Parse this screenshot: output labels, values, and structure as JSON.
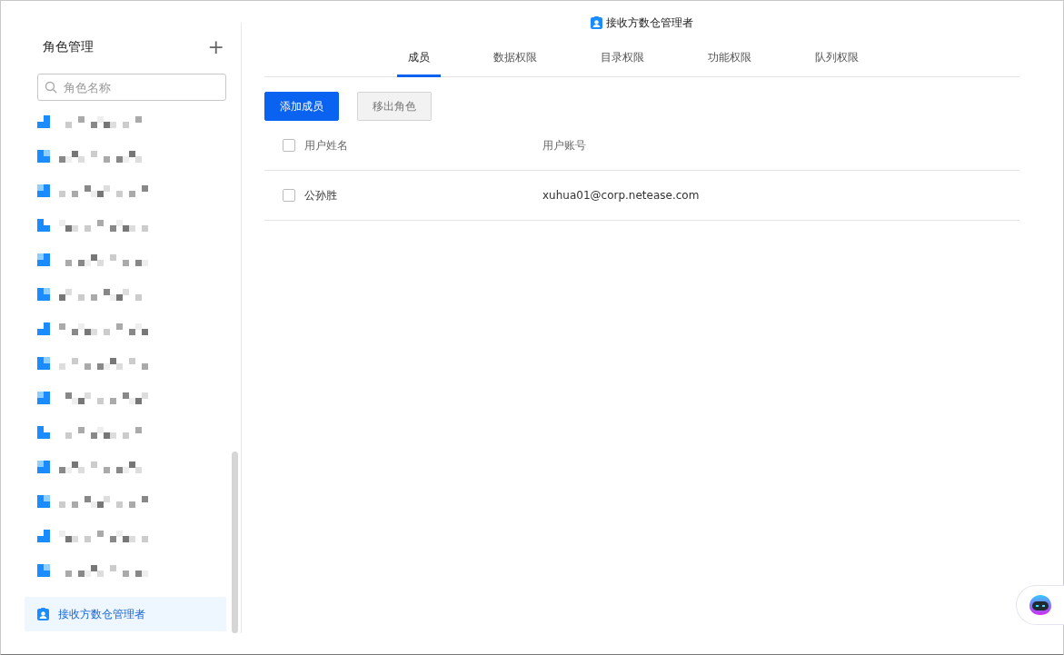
{
  "sidebar": {
    "title": "角色管理",
    "add_label": "+",
    "search": {
      "placeholder": "角色名称"
    },
    "items": [
      {
        "kind": "redacted",
        "selected": false
      },
      {
        "kind": "redacted",
        "selected": false
      },
      {
        "kind": "redacted",
        "selected": false
      },
      {
        "kind": "redacted",
        "selected": false
      },
      {
        "kind": "redacted",
        "selected": false
      },
      {
        "kind": "redacted",
        "selected": false
      },
      {
        "kind": "redacted",
        "selected": false
      },
      {
        "kind": "redacted",
        "selected": false
      },
      {
        "kind": "redacted",
        "selected": false
      },
      {
        "kind": "redacted",
        "selected": false
      },
      {
        "kind": "redacted",
        "selected": false
      },
      {
        "kind": "redacted",
        "selected": false
      },
      {
        "kind": "redacted",
        "selected": false
      },
      {
        "kind": "redacted",
        "selected": false
      },
      {
        "kind": "role",
        "label": "接收方数仓管理者",
        "selected": true
      }
    ]
  },
  "main": {
    "title": "接收方数仓管理者",
    "tabs": [
      {
        "label": "成员",
        "selected": true
      },
      {
        "label": "数据权限",
        "selected": false
      },
      {
        "label": "目录权限",
        "selected": false
      },
      {
        "label": "功能权限",
        "selected": false
      },
      {
        "label": "队列权限",
        "selected": false
      }
    ],
    "buttons": [
      {
        "label": "添加成员",
        "kind": "primary",
        "disabled": false
      },
      {
        "label": "移出角色",
        "kind": "default",
        "disabled": true
      }
    ],
    "table": {
      "columns": [
        "用户姓名",
        "用户账号"
      ],
      "header_checked": false,
      "rows": [
        {
          "name": "公孙胜",
          "account": "xuhua01@corp.netease.com",
          "checked": false
        }
      ]
    }
  }
}
